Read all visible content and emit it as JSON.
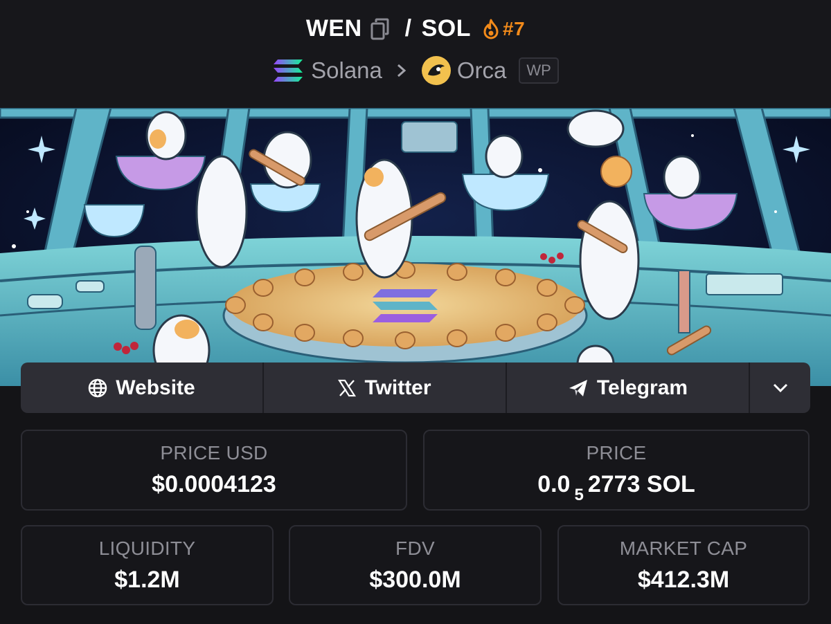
{
  "header": {
    "base_token": "WEN",
    "quote_token": "SOL",
    "separator": "/",
    "rank": "#7",
    "chain": "Solana",
    "dex": "Orca",
    "badge": "WP"
  },
  "links": {
    "website": "Website",
    "twitter": "Twitter",
    "telegram": "Telegram"
  },
  "stats": {
    "price_usd": {
      "label": "PRICE USD",
      "value": "$0.0004123"
    },
    "price": {
      "label": "PRICE",
      "prefix": "0.0",
      "zeros": "5",
      "digits": "2773",
      "unit": "SOL"
    },
    "liquidity": {
      "label": "LIQUIDITY",
      "value": "$1.2M"
    },
    "fdv": {
      "label": "FDV",
      "value": "$300.0M"
    },
    "market_cap": {
      "label": "MARKET CAP",
      "value": "$412.3M"
    }
  },
  "colors": {
    "accent_orange": "#f28a1a",
    "background": "#141417",
    "link_bar": "#2e2e35"
  },
  "icons": [
    "copy-icon",
    "fire-icon",
    "solana-logo",
    "chevron-right-icon",
    "orca-logo",
    "globe-icon",
    "x-icon",
    "telegram-icon",
    "chevron-down-icon"
  ]
}
